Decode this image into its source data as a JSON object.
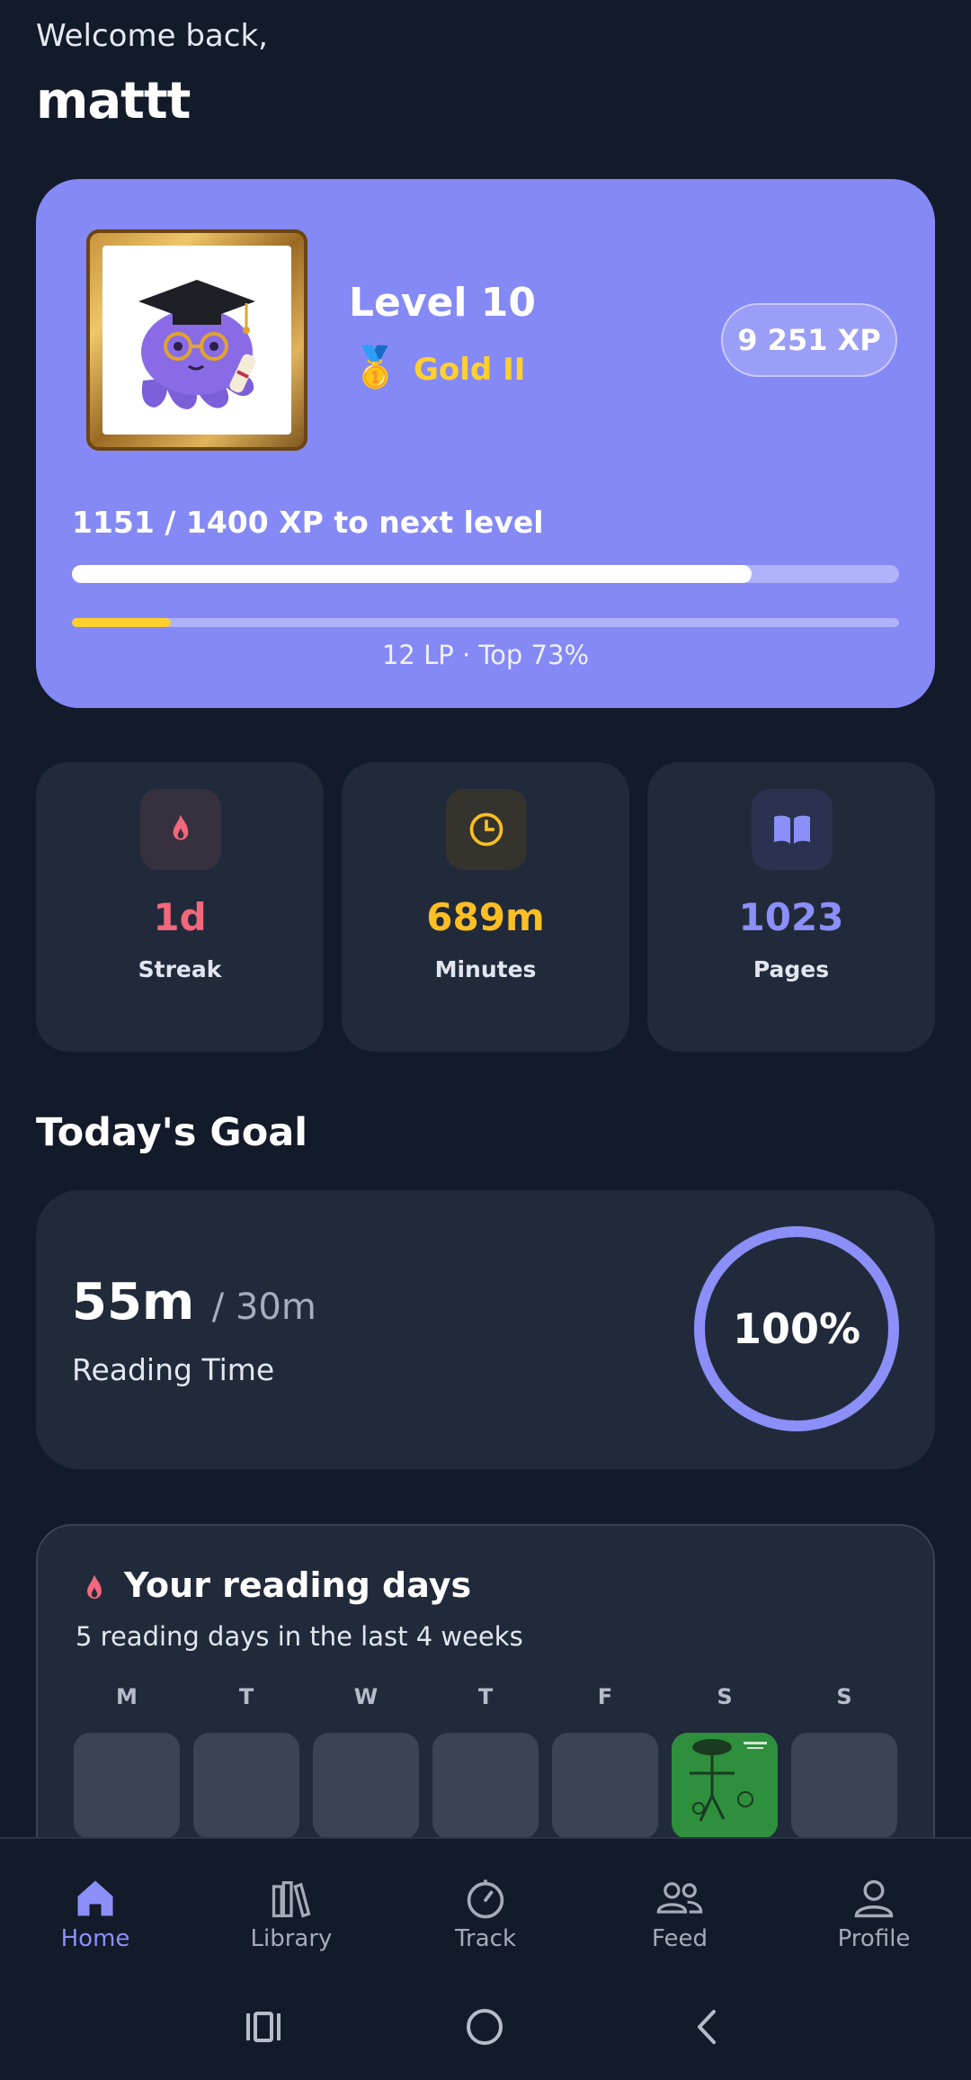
{
  "header": {
    "greeting": "Welcome back,",
    "username": "mattt"
  },
  "level_card": {
    "level_title": "Level 10",
    "rank_icon": "medal-icon",
    "rank_name": "Gold II",
    "total_xp": "9 251 XP",
    "xp_progress_text": "1151 / 1400 XP to next level",
    "xp_progress_fraction": 0.822,
    "lp_progress_fraction": 0.12,
    "lp_text": "12 LP · Top 73%",
    "avatar": "graduate-octopus-avatar"
  },
  "stats": [
    {
      "icon": "flame-icon",
      "value": "1d",
      "label": "Streak",
      "color": "#f2677c"
    },
    {
      "icon": "clock-icon",
      "value": "689m",
      "label": "Minutes",
      "color": "#fbbf24"
    },
    {
      "icon": "book-icon",
      "value": "1023",
      "label": "Pages",
      "color": "#8b8ff7"
    }
  ],
  "goal": {
    "heading": "Today's Goal",
    "value": "55m",
    "target": "/ 30m",
    "label": "Reading Time",
    "percent": "100%",
    "progress_fraction": 1.0
  },
  "reading_days": {
    "title": "Your reading days",
    "subtitle": "5 reading days in the last 4 weeks",
    "weekdays": [
      "M",
      "T",
      "W",
      "T",
      "F",
      "S",
      "S"
    ],
    "active_day_index": 5
  },
  "bottom_nav": [
    {
      "label": "Home",
      "icon": "home-icon",
      "active": true
    },
    {
      "label": "Library",
      "icon": "library-icon",
      "active": false
    },
    {
      "label": "Track",
      "icon": "timer-icon",
      "active": false
    },
    {
      "label": "Feed",
      "icon": "people-icon",
      "active": false
    },
    {
      "label": "Profile",
      "icon": "person-icon",
      "active": false
    }
  ],
  "colors": {
    "background": "#131a2a",
    "card": "#212a3a",
    "accent": "#8589f5",
    "gold": "#ffd02e"
  }
}
